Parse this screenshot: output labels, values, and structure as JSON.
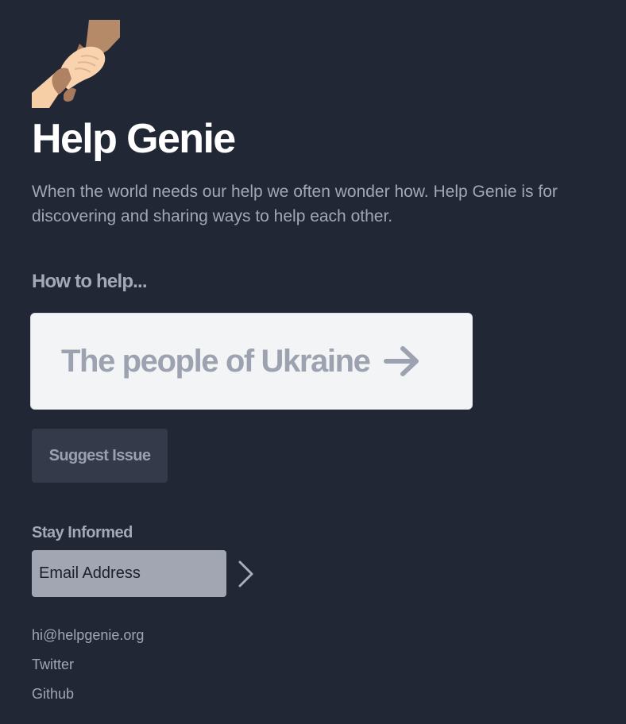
{
  "brand": {
    "logo_icon": "handshake-icon",
    "title": "Help Genie",
    "intro": "When the world needs our help we often wonder how. Help Genie is for discovering and sharing ways to help each other."
  },
  "help_section": {
    "heading": "How to help...",
    "issues": [
      {
        "label": "The people of Ukraine",
        "icon": "arrow-right-icon"
      }
    ],
    "suggest_button": "Suggest Issue"
  },
  "subscribe": {
    "heading": "Stay Informed",
    "email_placeholder": "Email Address",
    "submit_icon": "chevron-right-icon"
  },
  "footer": {
    "links": [
      "hi@helpgenie.org",
      "Twitter",
      "Github"
    ]
  },
  "colors": {
    "background": "#222735",
    "title": "#ffffff",
    "muted_text": "#a0a7b5",
    "card_background": "#f3f4f6",
    "button_background": "#343a4a",
    "input_background": "#a1a6b2"
  }
}
